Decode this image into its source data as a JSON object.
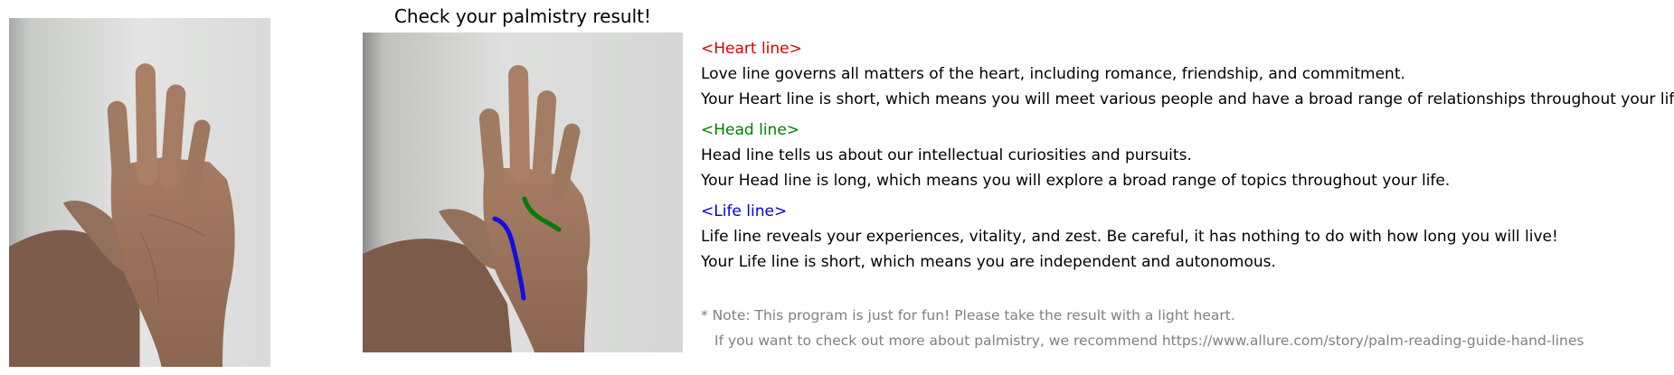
{
  "title": "Check your palmistry result!",
  "images": {
    "original_hand": "photo-of-raised-open-palm",
    "result_hand": "photo-of-open-palm-with-palm-lines-traced"
  },
  "lines": [
    {
      "key": "heart",
      "title": "<Heart line>",
      "color": "#e00000",
      "description": "Love line governs all matters of the heart, including romance, friendship, and commitment.",
      "result": "Your Heart line is short, which means you will meet various people and have a broad range of relationships throughout your life."
    },
    {
      "key": "head",
      "title": "<Head line>",
      "color": "#008000",
      "description": "Head line tells us about our intellectual curiosities and pursuits.",
      "result": "Your Head line is long, which means you will explore a broad range of topics throughout your life."
    },
    {
      "key": "life",
      "title": "<Life line>",
      "color": "#0000e0",
      "description": "Life line reveals your experiences, vitality, and zest. Be careful, it has nothing to do with how long you will live!",
      "result": "Your Life line is short, which means you are independent and autonomous."
    }
  ],
  "note": {
    "line1": "* Note: This program is just for fun! Please take the result with a light heart.",
    "line2": "If you want to check out more about palmistry, we recommend https://www.allure.com/story/palm-reading-guide-hand-lines"
  }
}
